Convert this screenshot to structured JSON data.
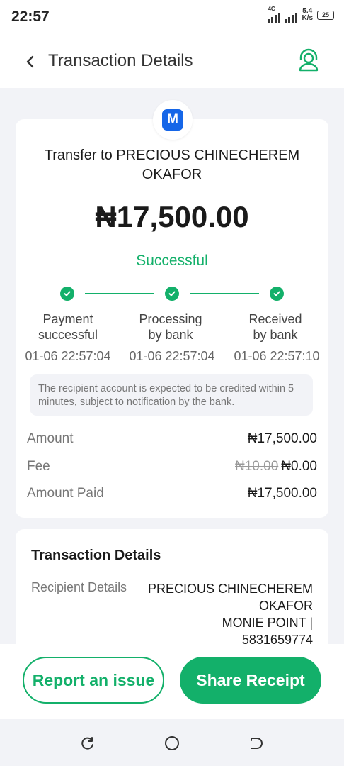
{
  "status_bar": {
    "time": "22:57",
    "network": "4G",
    "speed_value": "5.4",
    "speed_unit": "K/s",
    "battery": "25"
  },
  "header": {
    "title": "Transaction Details"
  },
  "summary": {
    "recipient_text": "Transfer to PRECIOUS CHINECHEREM OKAFOR",
    "amount": "₦17,500.00",
    "status": "Successful"
  },
  "timeline": {
    "steps": [
      {
        "label_line1": "Payment",
        "label_line2": "successful",
        "time": "01-06 22:57:04"
      },
      {
        "label_line1": "Processing",
        "label_line2": "by bank",
        "time": "01-06 22:57:04"
      },
      {
        "label_line1": "Received",
        "label_line2": "by bank",
        "time": "01-06 22:57:10"
      }
    ]
  },
  "notice": "The recipient account is expected to be credited within 5 minutes, subject to notification by the bank.",
  "breakdown": {
    "amount_label": "Amount",
    "amount_value": "₦17,500.00",
    "fee_label": "Fee",
    "fee_original": "₦10.00",
    "fee_value": "₦0.00",
    "paid_label": "Amount Paid",
    "paid_value": "₦17,500.00"
  },
  "details": {
    "title": "Transaction Details",
    "recipient_label": "Recipient Details",
    "recipient_name": "PRECIOUS CHINECHEREM OKAFOR",
    "recipient_bank": "MONIE POINT |",
    "recipient_account": "5831659774"
  },
  "actions": {
    "report_label": "Report an issue",
    "share_label": "Share Receipt"
  },
  "colors": {
    "accent": "#13b06a",
    "brand_logo": "#1566e8"
  },
  "icons": {
    "back": "chevron-left-icon",
    "support": "headset-icon",
    "logo": "moniepoint-logo",
    "check": "check-circle-icon"
  }
}
